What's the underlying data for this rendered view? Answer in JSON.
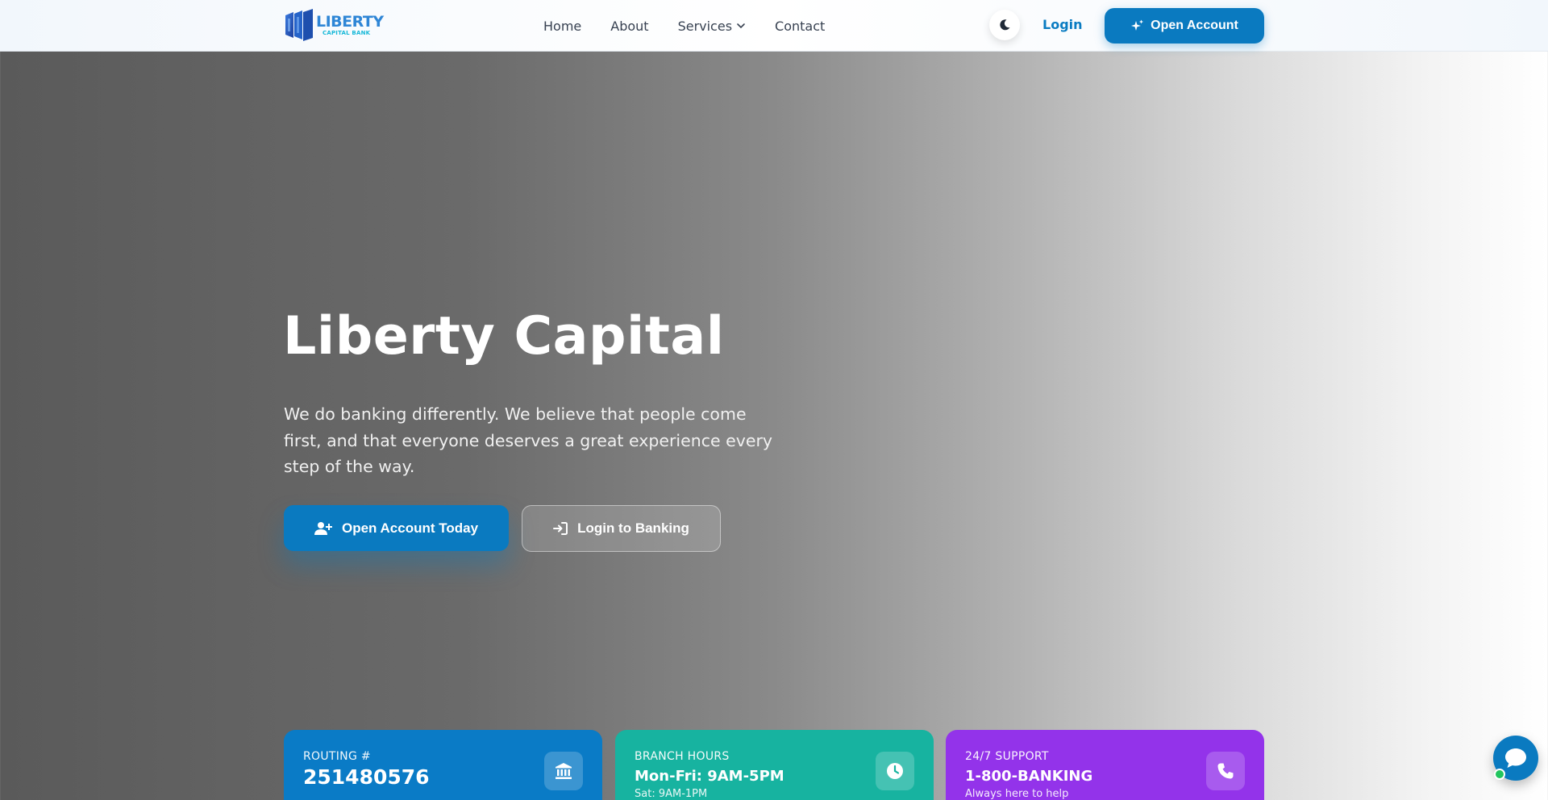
{
  "brand": {
    "name": "LIBERTY",
    "tagline": "CAPITAL BANK",
    "logo_icon": "bank-building-logo-icon",
    "colors": {
      "primary": "#0a7ac0",
      "brand_blue": "#2f86d6",
      "brand_cyan": "#16b8d8"
    }
  },
  "nav": {
    "links": [
      {
        "label": "Home"
      },
      {
        "label": "About"
      },
      {
        "label": "Services",
        "has_dropdown": true
      },
      {
        "label": "Contact"
      }
    ],
    "theme_toggle_icon": "moon-icon",
    "login_label": "Login",
    "open_account_label": "Open Account",
    "open_account_icon": "sparkles-icon"
  },
  "hero": {
    "title": "Liberty Capital",
    "description": "We do banking differently. We believe that people come first, and that everyone deserves a great experience every step of the way.",
    "primary_cta": {
      "label": "Open Account Today",
      "icon": "user-plus-icon"
    },
    "secondary_cta": {
      "label": "Login to Banking",
      "icon": "sign-in-icon"
    }
  },
  "info_cards": [
    {
      "label": "ROUTING #",
      "value": "251480576",
      "sub": "",
      "icon": "bank-icon",
      "color": "#0a7bc6"
    },
    {
      "label": "BRANCH HOURS",
      "value": "Mon-Fri: 9AM-5PM",
      "sub": "Sat: 9AM-1PM",
      "icon": "clock-icon",
      "color": "#17b3a0"
    },
    {
      "label": "24/7 SUPPORT",
      "value": "1-800-BANKING",
      "sub": "Always here to help",
      "icon": "phone-icon",
      "color": "#9333ea"
    }
  ],
  "chat": {
    "icon": "chat-bubble-icon",
    "status_color": "#22c55e"
  }
}
